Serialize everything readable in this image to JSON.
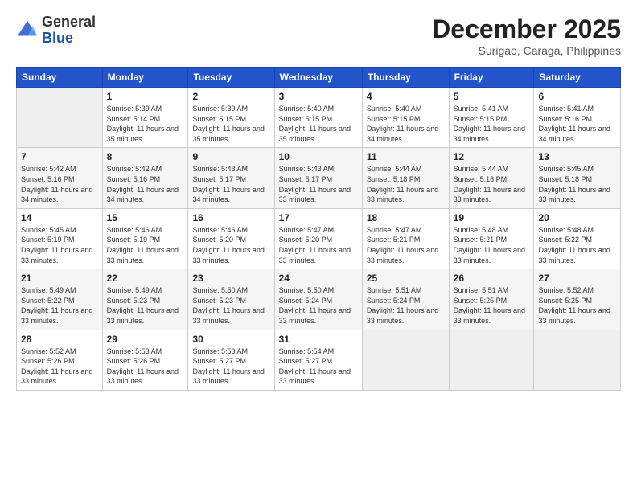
{
  "logo": {
    "general": "General",
    "blue": "Blue"
  },
  "header": {
    "month_year": "December 2025",
    "location": "Surigao, Caraga, Philippines"
  },
  "weekdays": [
    "Sunday",
    "Monday",
    "Tuesday",
    "Wednesday",
    "Thursday",
    "Friday",
    "Saturday"
  ],
  "weeks": [
    [
      {
        "day": "",
        "empty": true
      },
      {
        "day": "1",
        "sunrise": "5:39 AM",
        "sunset": "5:14 PM",
        "daylight": "11 hours and 35 minutes."
      },
      {
        "day": "2",
        "sunrise": "5:39 AM",
        "sunset": "5:15 PM",
        "daylight": "11 hours and 35 minutes."
      },
      {
        "day": "3",
        "sunrise": "5:40 AM",
        "sunset": "5:15 PM",
        "daylight": "11 hours and 35 minutes."
      },
      {
        "day": "4",
        "sunrise": "5:40 AM",
        "sunset": "5:15 PM",
        "daylight": "11 hours and 34 minutes."
      },
      {
        "day": "5",
        "sunrise": "5:41 AM",
        "sunset": "5:15 PM",
        "daylight": "11 hours and 34 minutes."
      },
      {
        "day": "6",
        "sunrise": "5:41 AM",
        "sunset": "5:16 PM",
        "daylight": "11 hours and 34 minutes."
      }
    ],
    [
      {
        "day": "7",
        "sunrise": "5:42 AM",
        "sunset": "5:16 PM",
        "daylight": "11 hours and 34 minutes."
      },
      {
        "day": "8",
        "sunrise": "5:42 AM",
        "sunset": "5:16 PM",
        "daylight": "11 hours and 34 minutes."
      },
      {
        "day": "9",
        "sunrise": "5:43 AM",
        "sunset": "5:17 PM",
        "daylight": "11 hours and 34 minutes."
      },
      {
        "day": "10",
        "sunrise": "5:43 AM",
        "sunset": "5:17 PM",
        "daylight": "11 hours and 33 minutes."
      },
      {
        "day": "11",
        "sunrise": "5:44 AM",
        "sunset": "5:18 PM",
        "daylight": "11 hours and 33 minutes."
      },
      {
        "day": "12",
        "sunrise": "5:44 AM",
        "sunset": "5:18 PM",
        "daylight": "11 hours and 33 minutes."
      },
      {
        "day": "13",
        "sunrise": "5:45 AM",
        "sunset": "5:18 PM",
        "daylight": "11 hours and 33 minutes."
      }
    ],
    [
      {
        "day": "14",
        "sunrise": "5:45 AM",
        "sunset": "5:19 PM",
        "daylight": "11 hours and 33 minutes."
      },
      {
        "day": "15",
        "sunrise": "5:46 AM",
        "sunset": "5:19 PM",
        "daylight": "11 hours and 33 minutes."
      },
      {
        "day": "16",
        "sunrise": "5:46 AM",
        "sunset": "5:20 PM",
        "daylight": "11 hours and 33 minutes."
      },
      {
        "day": "17",
        "sunrise": "5:47 AM",
        "sunset": "5:20 PM",
        "daylight": "11 hours and 33 minutes."
      },
      {
        "day": "18",
        "sunrise": "5:47 AM",
        "sunset": "5:21 PM",
        "daylight": "11 hours and 33 minutes."
      },
      {
        "day": "19",
        "sunrise": "5:48 AM",
        "sunset": "5:21 PM",
        "daylight": "11 hours and 33 minutes."
      },
      {
        "day": "20",
        "sunrise": "5:48 AM",
        "sunset": "5:22 PM",
        "daylight": "11 hours and 33 minutes."
      }
    ],
    [
      {
        "day": "21",
        "sunrise": "5:49 AM",
        "sunset": "5:22 PM",
        "daylight": "11 hours and 33 minutes."
      },
      {
        "day": "22",
        "sunrise": "5:49 AM",
        "sunset": "5:23 PM",
        "daylight": "11 hours and 33 minutes."
      },
      {
        "day": "23",
        "sunrise": "5:50 AM",
        "sunset": "5:23 PM",
        "daylight": "11 hours and 33 minutes."
      },
      {
        "day": "24",
        "sunrise": "5:50 AM",
        "sunset": "5:24 PM",
        "daylight": "11 hours and 33 minutes."
      },
      {
        "day": "25",
        "sunrise": "5:51 AM",
        "sunset": "5:24 PM",
        "daylight": "11 hours and 33 minutes."
      },
      {
        "day": "26",
        "sunrise": "5:51 AM",
        "sunset": "5:25 PM",
        "daylight": "11 hours and 33 minutes."
      },
      {
        "day": "27",
        "sunrise": "5:52 AM",
        "sunset": "5:25 PM",
        "daylight": "11 hours and 33 minutes."
      }
    ],
    [
      {
        "day": "28",
        "sunrise": "5:52 AM",
        "sunset": "5:26 PM",
        "daylight": "11 hours and 33 minutes."
      },
      {
        "day": "29",
        "sunrise": "5:53 AM",
        "sunset": "5:26 PM",
        "daylight": "11 hours and 33 minutes."
      },
      {
        "day": "30",
        "sunrise": "5:53 AM",
        "sunset": "5:27 PM",
        "daylight": "11 hours and 33 minutes."
      },
      {
        "day": "31",
        "sunrise": "5:54 AM",
        "sunset": "5:27 PM",
        "daylight": "11 hours and 33 minutes."
      },
      {
        "day": "",
        "empty": true
      },
      {
        "day": "",
        "empty": true
      },
      {
        "day": "",
        "empty": true
      }
    ]
  ]
}
